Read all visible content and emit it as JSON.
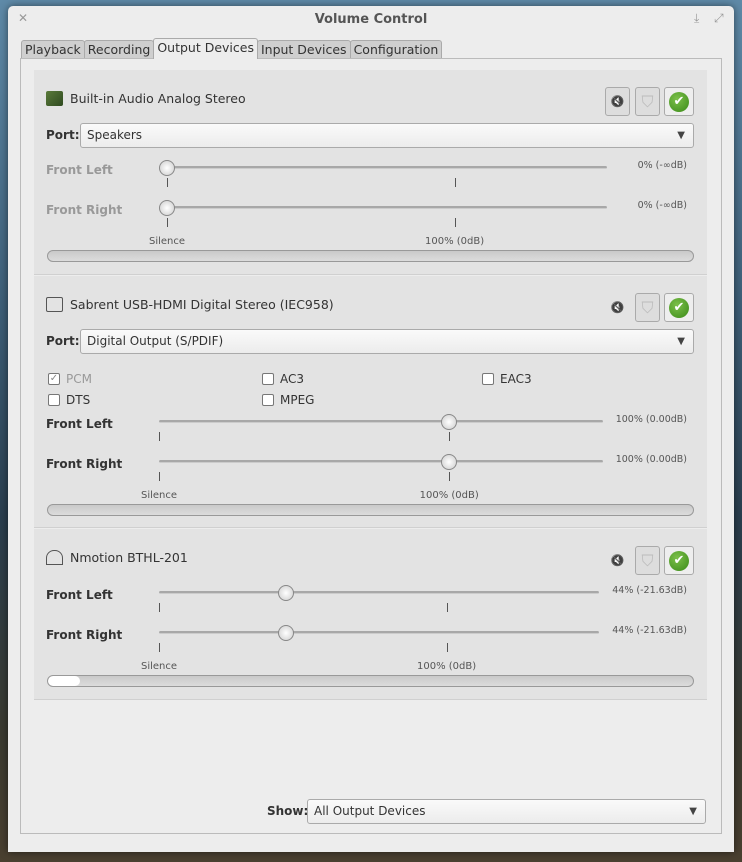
{
  "window": {
    "title": "Volume Control"
  },
  "tabs": [
    {
      "label": "Playback"
    },
    {
      "label": "Recording"
    },
    {
      "label": "Output Devices",
      "active": true
    },
    {
      "label": "Input Devices"
    },
    {
      "label": "Configuration"
    }
  ],
  "port_label": "Port:",
  "scale": {
    "silence": "Silence",
    "normal": "100% (0dB)",
    "max_percent": 153
  },
  "devices": [
    {
      "name": "Built-in Audio Analog Stereo",
      "icon": "sound-card-icon",
      "port": "Speakers",
      "muted": true,
      "locked_disabled": true,
      "is_default": true,
      "channels": [
        {
          "label": "Front Left",
          "percent": 0,
          "value_text": "0% (-∞dB)"
        },
        {
          "label": "Front Right",
          "percent": 0,
          "value_text": "0% (-∞dB)"
        }
      ],
      "disabled": true,
      "peak_level": 0
    },
    {
      "name": "Sabrent USB-HDMI Digital Stereo (IEC958)",
      "icon": "hdmi-icon",
      "port": "Digital Output (S/PDIF)",
      "muted": false,
      "is_default": true,
      "formats": [
        {
          "label": "PCM",
          "checked": true,
          "disabled": true
        },
        {
          "label": "AC3",
          "checked": false
        },
        {
          "label": "EAC3",
          "checked": false
        },
        {
          "label": "DTS",
          "checked": false
        },
        {
          "label": "MPEG",
          "checked": false
        }
      ],
      "channels": [
        {
          "label": "Front Left",
          "percent": 100,
          "value_text": "100% (0.00dB)"
        },
        {
          "label": "Front Right",
          "percent": 100,
          "value_text": "100% (0.00dB)"
        }
      ],
      "peak_level": 0
    },
    {
      "name": "Nmotion BTHL-201",
      "icon": "headphones-icon",
      "muted": false,
      "is_default": true,
      "channels": [
        {
          "label": "Front Left",
          "percent": 44,
          "value_text": "44% (-21.63dB)"
        },
        {
          "label": "Front Right",
          "percent": 44,
          "value_text": "44% (-21.63dB)"
        }
      ],
      "peak_level": 0.05
    }
  ],
  "show": {
    "label": "Show:",
    "value": "All Output Devices"
  },
  "icons": {
    "close": "✕",
    "minimize": "⤓",
    "maximize": "⤢",
    "mute": "🔇",
    "lock": "⛉",
    "check": "✔",
    "dropdown": "▼"
  }
}
